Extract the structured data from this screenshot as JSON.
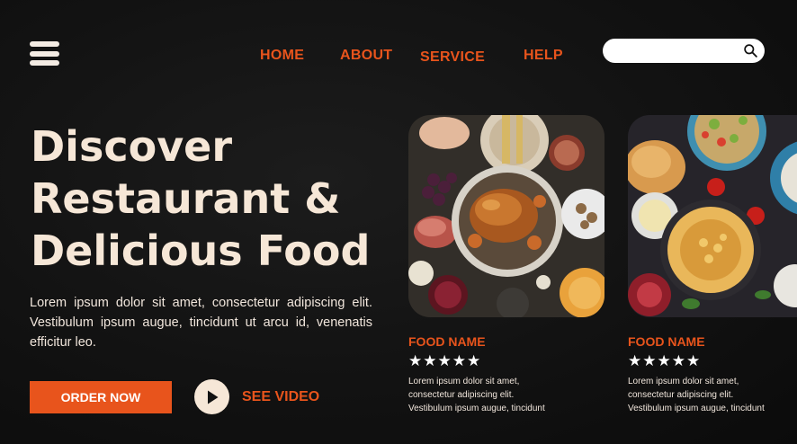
{
  "nav": {
    "links": [
      "HOME",
      "ABOUT",
      "SERVICE",
      "HELP"
    ],
    "menu_icon": "hamburger-menu-icon",
    "search": {
      "placeholder": "",
      "icon": "search-icon"
    }
  },
  "hero": {
    "title_lines": [
      "Discover",
      "Restaurant &",
      "Delicious Food"
    ],
    "description": "Lorem ipsum dolor sit amet, consectetur adipiscing elit. Vestibulum ipsum augue, tincidunt ut arcu id, venenatis efficitur leo.",
    "order_button": "ORDER NOW",
    "video_button": "SEE VIDEO",
    "video_icon": "play-icon"
  },
  "cards": [
    {
      "name": "FOOD NAME",
      "stars": "★★★★★",
      "rating": 5,
      "desc_lines": [
        "Lorem ipsum dolor sit amet,",
        "consectetur adipiscing elit.",
        "Vestibulum ipsum augue, tincidunt"
      ]
    },
    {
      "name": "FOOD NAME",
      "stars": "★★★★★",
      "rating": 5,
      "desc_lines": [
        "Lorem ipsum dolor sit amet,",
        "consectetur adipiscing elit.",
        "Vestibulum ipsum augue, tincidunt"
      ]
    }
  ],
  "colors": {
    "accent": "#e8541c",
    "cream": "#f6e7d7",
    "background": "#141414"
  }
}
